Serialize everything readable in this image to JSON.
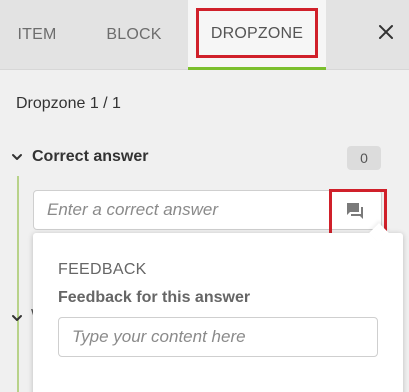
{
  "tabs": [
    {
      "label": "ITEM"
    },
    {
      "label": "BLOCK"
    },
    {
      "label": "DROPZONE"
    }
  ],
  "active_tab": "DROPZONE",
  "icons": {
    "close": "close-icon",
    "chevron": "chevron-down-icon",
    "feedback": "comment-icon"
  },
  "colors": {
    "accent_green": "#7bbf2d",
    "highlight_red": "#d0202a"
  },
  "dropzone": {
    "heading": "Dropzone 1 / 1"
  },
  "correct_answer": {
    "title": "Correct answer",
    "count": "0",
    "input_placeholder": "Enter a correct answer",
    "input_value": ""
  },
  "feedback": {
    "title": "FEEDBACK",
    "label": "Feedback for this answer",
    "input_placeholder": "Type your content here",
    "input_value": ""
  }
}
